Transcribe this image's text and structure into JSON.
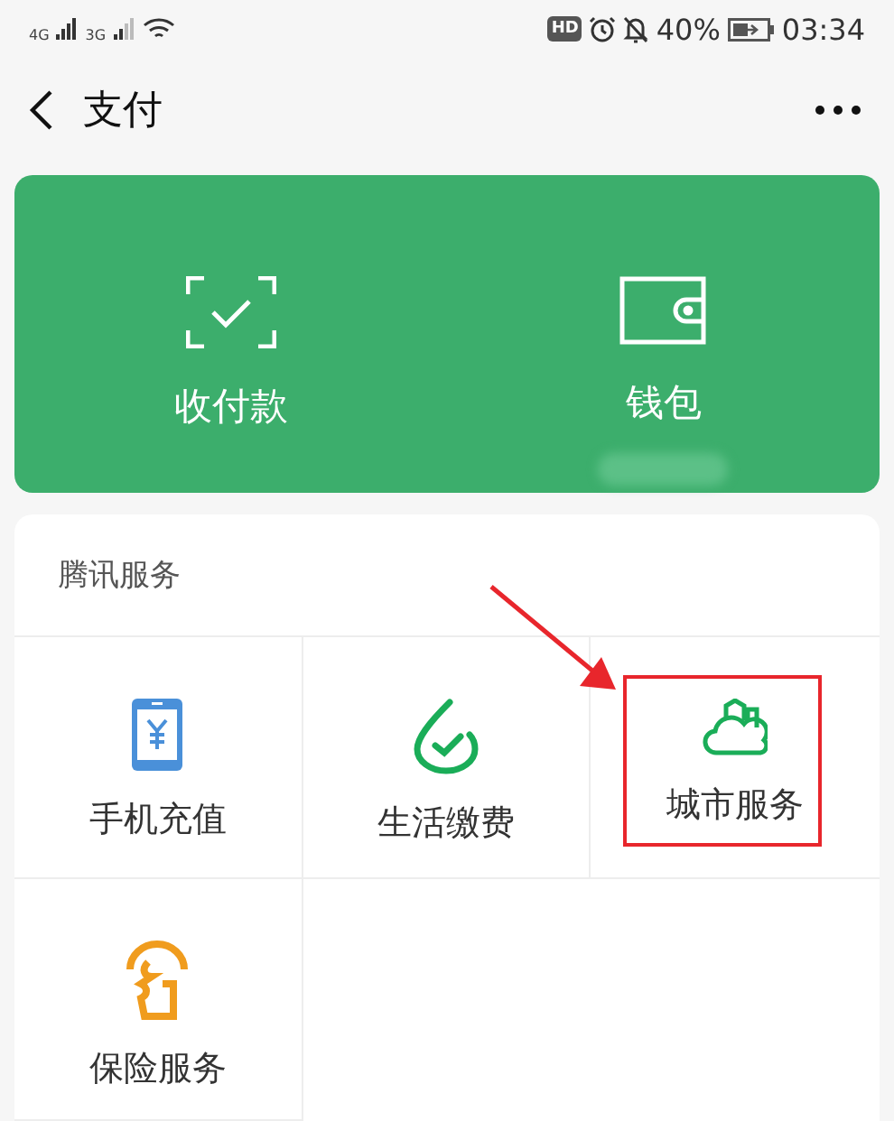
{
  "status_bar": {
    "sim_1": "4G",
    "sim_2": "3G",
    "hd": "HD",
    "battery": "40%",
    "time": "03:34"
  },
  "header": {
    "title": "支付"
  },
  "wallet_card": {
    "actions": [
      {
        "kind": "scan",
        "label": "收付款",
        "balance_blurred": false
      },
      {
        "kind": "wallet",
        "label": "钱包",
        "balance_blurred": true
      }
    ]
  },
  "services": {
    "title": "腾讯服务",
    "items": [
      {
        "kind": "phone",
        "label": "手机充值",
        "highlighted": false
      },
      {
        "kind": "bill",
        "label": "生活缴费",
        "highlighted": false
      },
      {
        "kind": "city",
        "label": "城市服务",
        "highlighted": true
      },
      {
        "kind": "insurance",
        "label": "保险服务",
        "highlighted": false
      }
    ]
  }
}
